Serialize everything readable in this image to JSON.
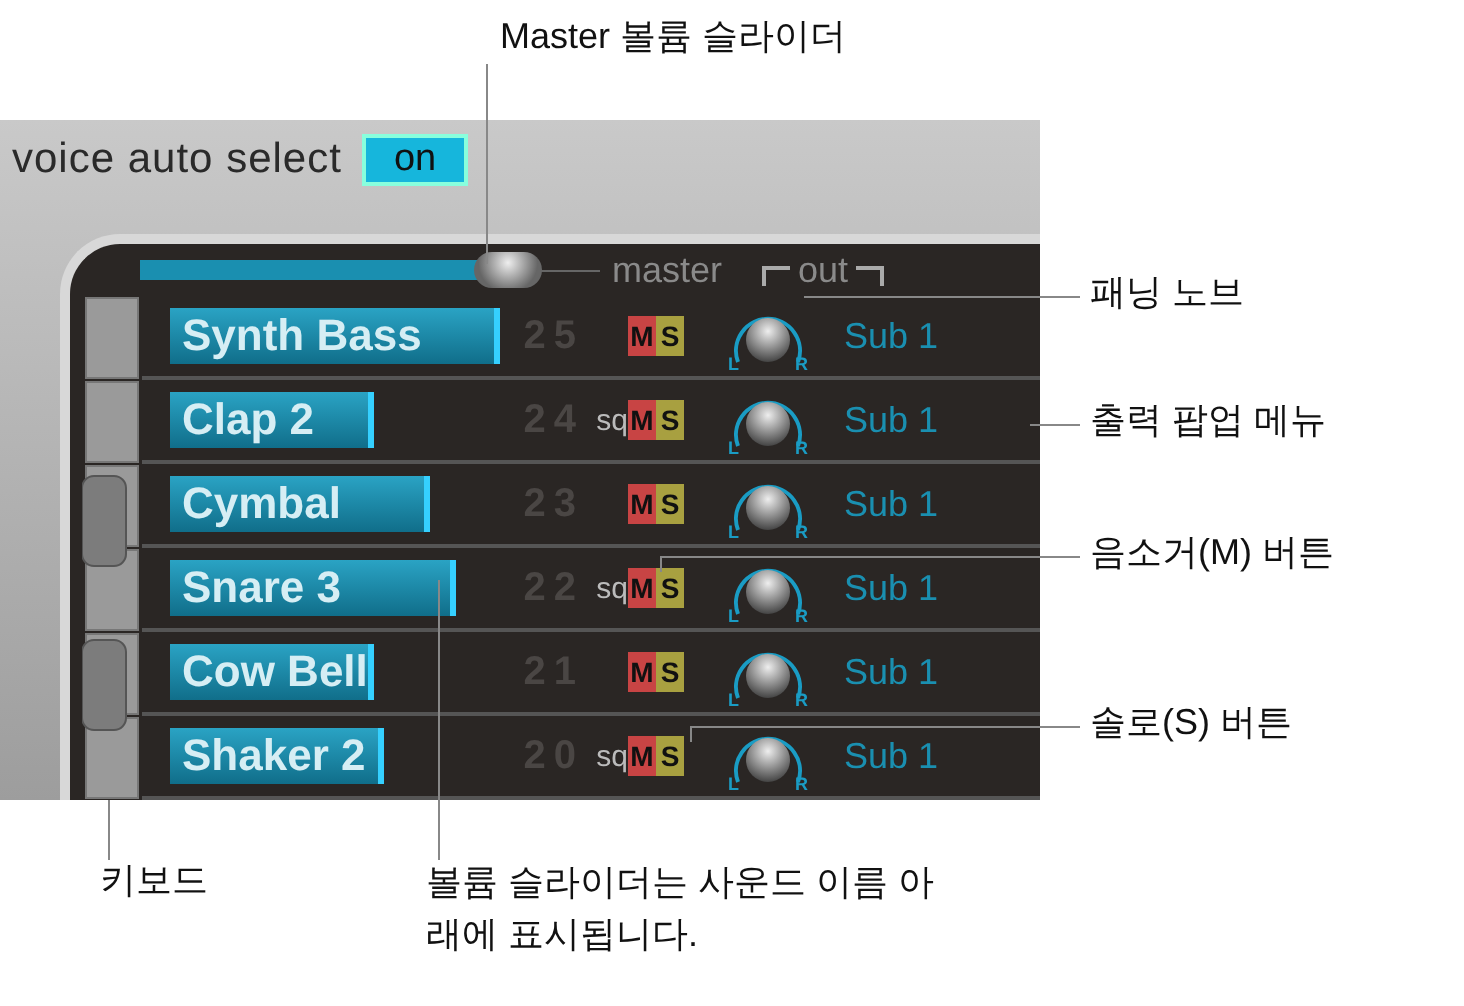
{
  "callouts": [
    {
      "text": "Master 볼륨 슬라이더"
    },
    {
      "text": "패닝 노브"
    },
    {
      "text": "출력 팝업 메뉴"
    },
    {
      "text": "음소거(M) 버튼"
    },
    {
      "text": "솔로(S) 버튼"
    },
    {
      "text": "키보드"
    },
    {
      "text": "볼륨 슬라이더는 사운드 이름 아래에 표시됩니다."
    }
  ],
  "voice_auto_select": {
    "label": "voice auto select",
    "value": "on"
  },
  "master": {
    "label": "master",
    "level": 0.8
  },
  "out_label": "out",
  "voices": [
    {
      "name": "Synth Bass",
      "level": 0.98,
      "number": "25",
      "mute": "M",
      "solo": "S",
      "pan_left": "L",
      "pan_right": "R",
      "output": "Sub 1"
    },
    {
      "name": "Clap 2",
      "level": 0.6,
      "number": "24",
      "sq": "sq",
      "mute": "M",
      "solo": "S",
      "pan_left": "L",
      "pan_right": "R",
      "output": "Sub 1"
    },
    {
      "name": "Cymbal",
      "level": 0.77,
      "number": "23",
      "mute": "M",
      "solo": "S",
      "pan_left": "L",
      "pan_right": "R",
      "output": "Sub 1"
    },
    {
      "name": "Snare 3",
      "level": 0.85,
      "number": "22",
      "sq": "sq",
      "mute": "M",
      "solo": "S",
      "pan_left": "L",
      "pan_right": "R",
      "output": "Sub 1"
    },
    {
      "name": "Cow Bell",
      "level": 0.6,
      "number": "21",
      "mute": "M",
      "solo": "S",
      "pan_left": "L",
      "pan_right": "R",
      "output": "Sub 1"
    },
    {
      "name": "Shaker 2",
      "level": 0.63,
      "number": "20",
      "sq": "sq",
      "mute": "M",
      "solo": "S",
      "pan_left": "L",
      "pan_right": "R",
      "output": "Sub 1"
    }
  ]
}
